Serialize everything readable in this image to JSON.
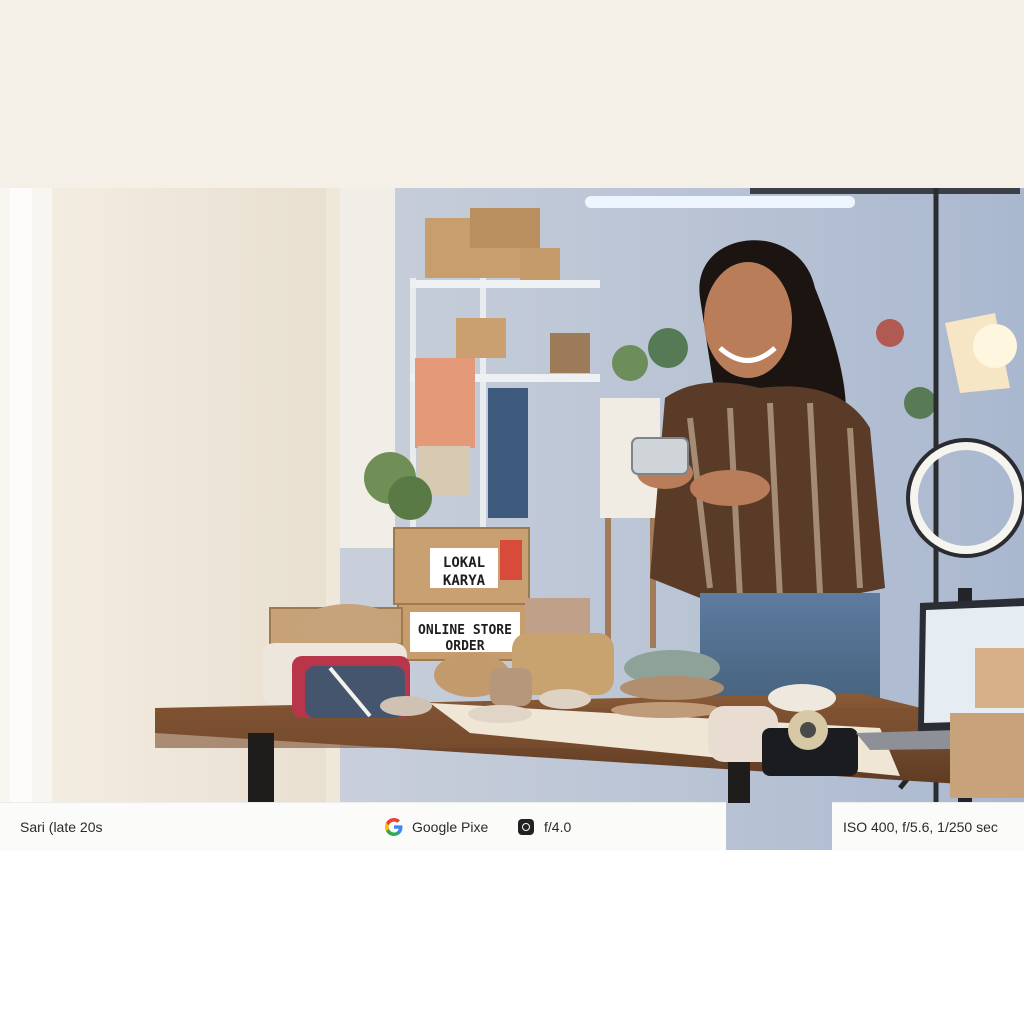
{
  "photo": {
    "box_top_label_line1": "LOKAL",
    "box_top_label_line2": "KARYA",
    "box_bottom_label_line1": "ONLINE STORE",
    "box_bottom_label_line2": "ORDER"
  },
  "caption": {
    "subject": "Sari (late 20s",
    "device": "Google Pixe",
    "device_icon": "google-g-logo",
    "aperture": "f/4.0",
    "aperture_icon": "camera-icon",
    "exif": "ISO 400, f/5.6, 1/250 sec"
  },
  "colors": {
    "top_band": "#f4efe7",
    "caption_bg": "#fbfbfa"
  }
}
